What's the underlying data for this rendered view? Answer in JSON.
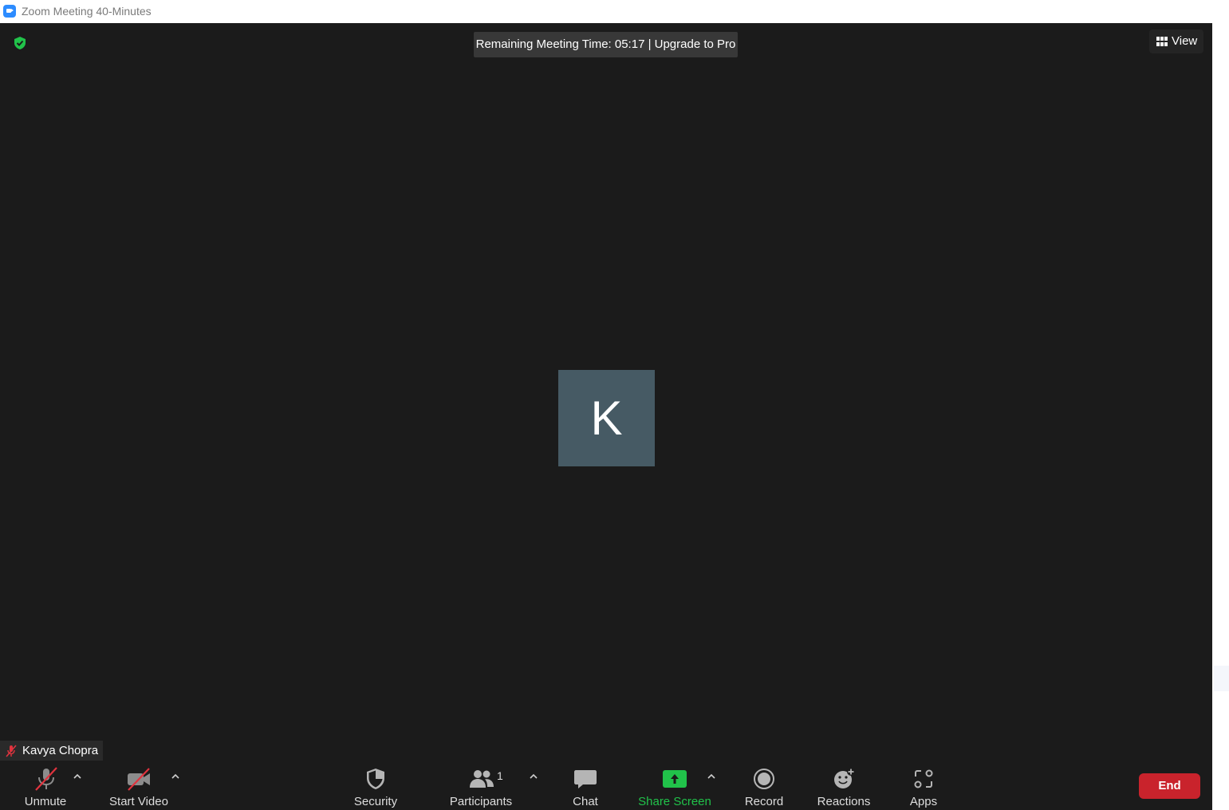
{
  "window": {
    "title": "Zoom Meeting 40-Minutes"
  },
  "top_bar": {
    "timer_text": "Remaining Meeting Time: 05:17 | Upgrade to Pro",
    "view_label": "View"
  },
  "participant": {
    "initial": "K",
    "name": "Kavya Chopra"
  },
  "toolbar": {
    "unmute": "Unmute",
    "start_video": "Start Video",
    "security": "Security",
    "participants": "Participants",
    "participants_count": "1",
    "chat": "Chat",
    "share_screen": "Share Screen",
    "record": "Record",
    "reactions": "Reactions",
    "apps": "Apps",
    "end": "End"
  },
  "colors": {
    "background": "#1b1b1b",
    "share_green": "#21c24a",
    "end_red": "#c9232c",
    "muted_red": "#e0333e",
    "avatar_bg": "#465a64",
    "zoom_blue": "#2d8cff"
  }
}
